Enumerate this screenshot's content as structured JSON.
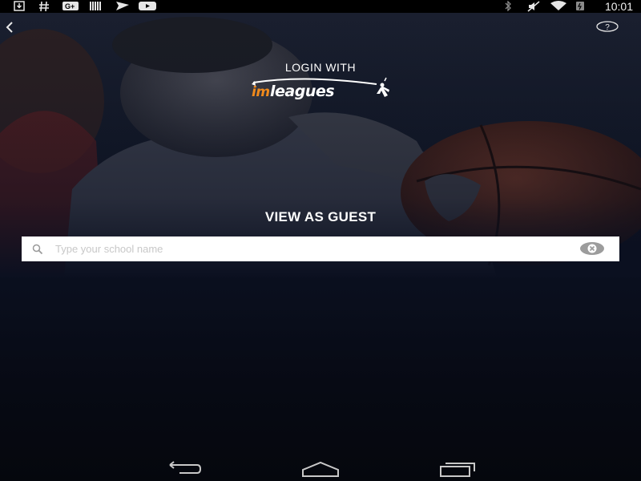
{
  "status_bar": {
    "time": "10:01",
    "left_icons": [
      "download-icon",
      "hashtag-icon",
      "google-plus-icon",
      "barcode-icon",
      "paper-plane-icon",
      "youtube-icon"
    ],
    "right_icons": [
      "bluetooth-icon",
      "mute-icon",
      "wifi-icon",
      "battery-icon"
    ]
  },
  "header": {
    "back_icon": "chevron-left-icon",
    "help_icon": "question-mark-icon",
    "help_label": "?"
  },
  "login": {
    "label": "LOGIN WITH",
    "brand_prefix": "im",
    "brand_name": "leagues"
  },
  "guest": {
    "title": "VIEW AS GUEST"
  },
  "search": {
    "placeholder": "Type your school name",
    "value": ""
  },
  "nav_bar": {
    "buttons": [
      "back-icon",
      "home-icon",
      "recent-apps-icon"
    ]
  },
  "colors": {
    "brand_orange": "#f08a1c",
    "background": "#0b1020",
    "text": "#ffffff"
  }
}
